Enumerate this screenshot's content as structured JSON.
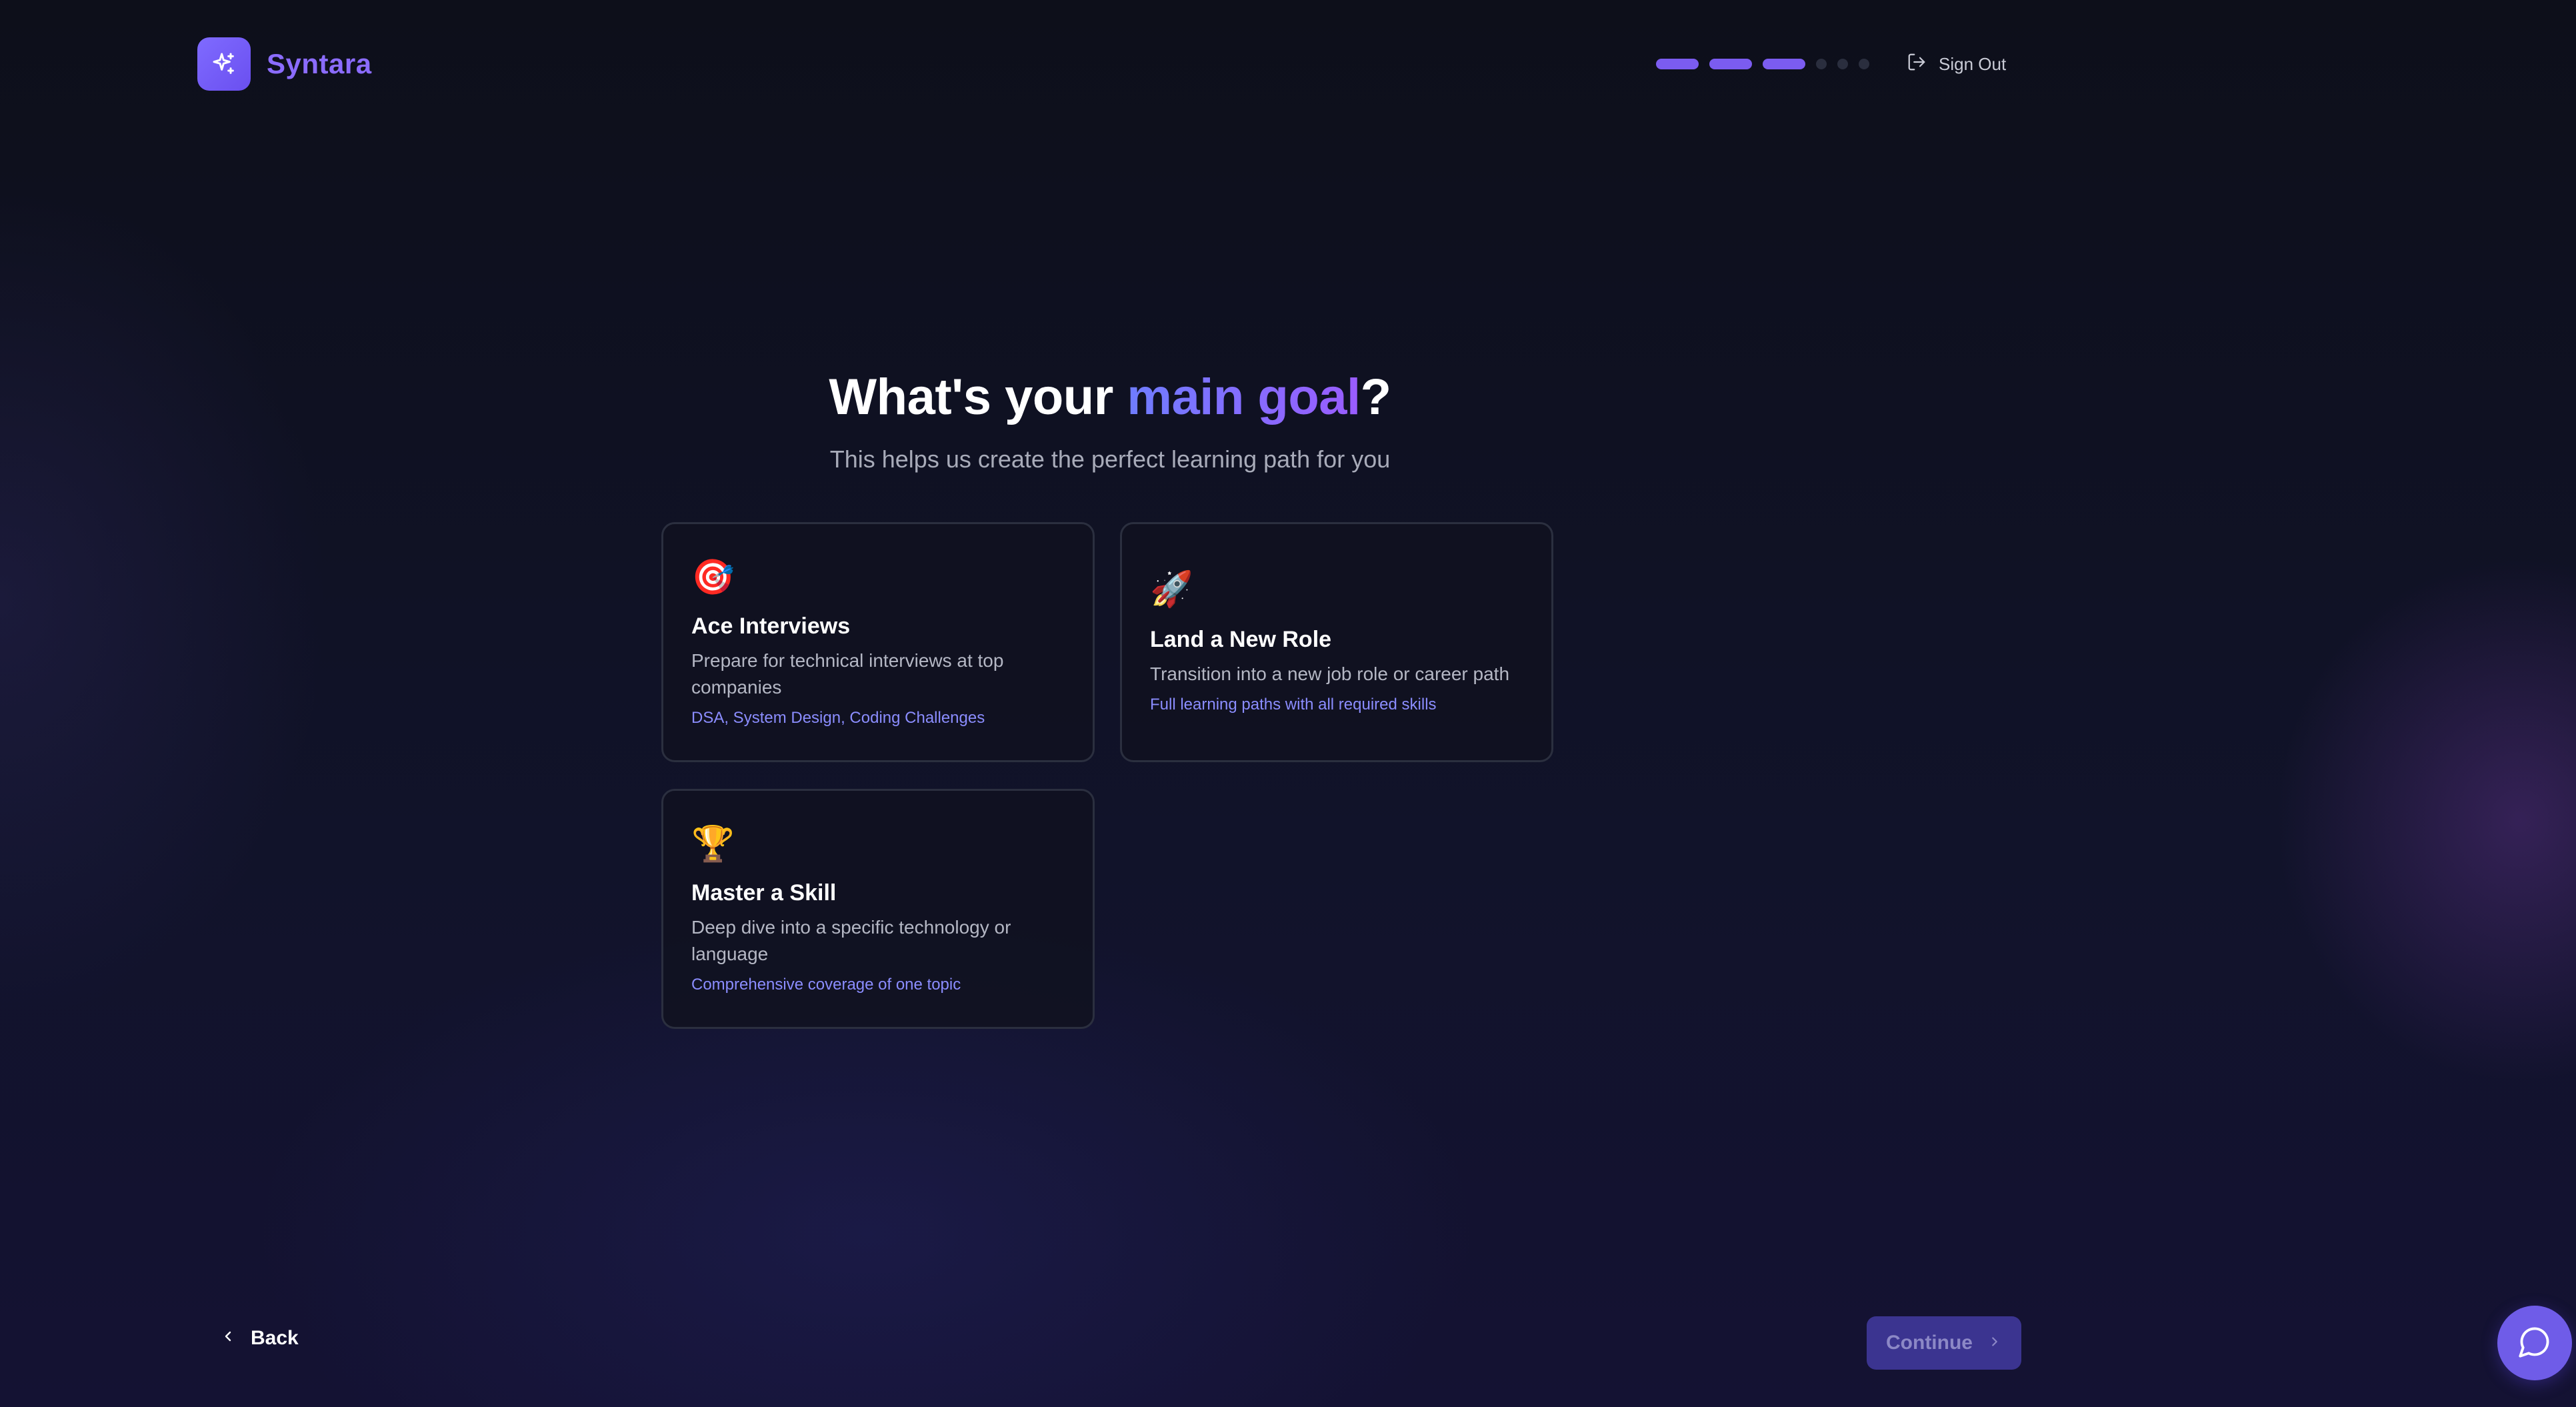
{
  "app": {
    "name": "Syntara"
  },
  "header": {
    "progress": {
      "total_steps": 6,
      "completed_steps": 3
    },
    "sign_out_label": "Sign Out"
  },
  "heading": {
    "prefix": "What's your ",
    "accent": "main goal",
    "suffix": "?",
    "subtitle": "This helps us create the perfect learning path for you"
  },
  "goals": [
    {
      "emoji": "🎯",
      "title": "Ace Interviews",
      "description": "Prepare for technical interviews at top companies",
      "tags": "DSA, System Design, Coding Challenges"
    },
    {
      "emoji": "🚀",
      "title": "Land a New Role",
      "description": "Transition into a new job role or career path",
      "tags": "Full learning paths with all required skills"
    },
    {
      "emoji": "🏆",
      "title": "Master a Skill",
      "description": "Deep dive into a specific technology or language",
      "tags": "Comprehensive coverage of one topic"
    }
  ],
  "footer": {
    "back_label": "Back",
    "continue_label": "Continue"
  },
  "colors": {
    "accent": "#7b5cf0",
    "background": "#0d0f1a",
    "tag_text": "#8b8dff"
  },
  "icons": {
    "logo": "sparkles-icon",
    "sign_out": "logout-icon",
    "back": "chevron-left-icon",
    "continue": "chevron-right-icon",
    "chat": "chat-bubble-icon"
  }
}
